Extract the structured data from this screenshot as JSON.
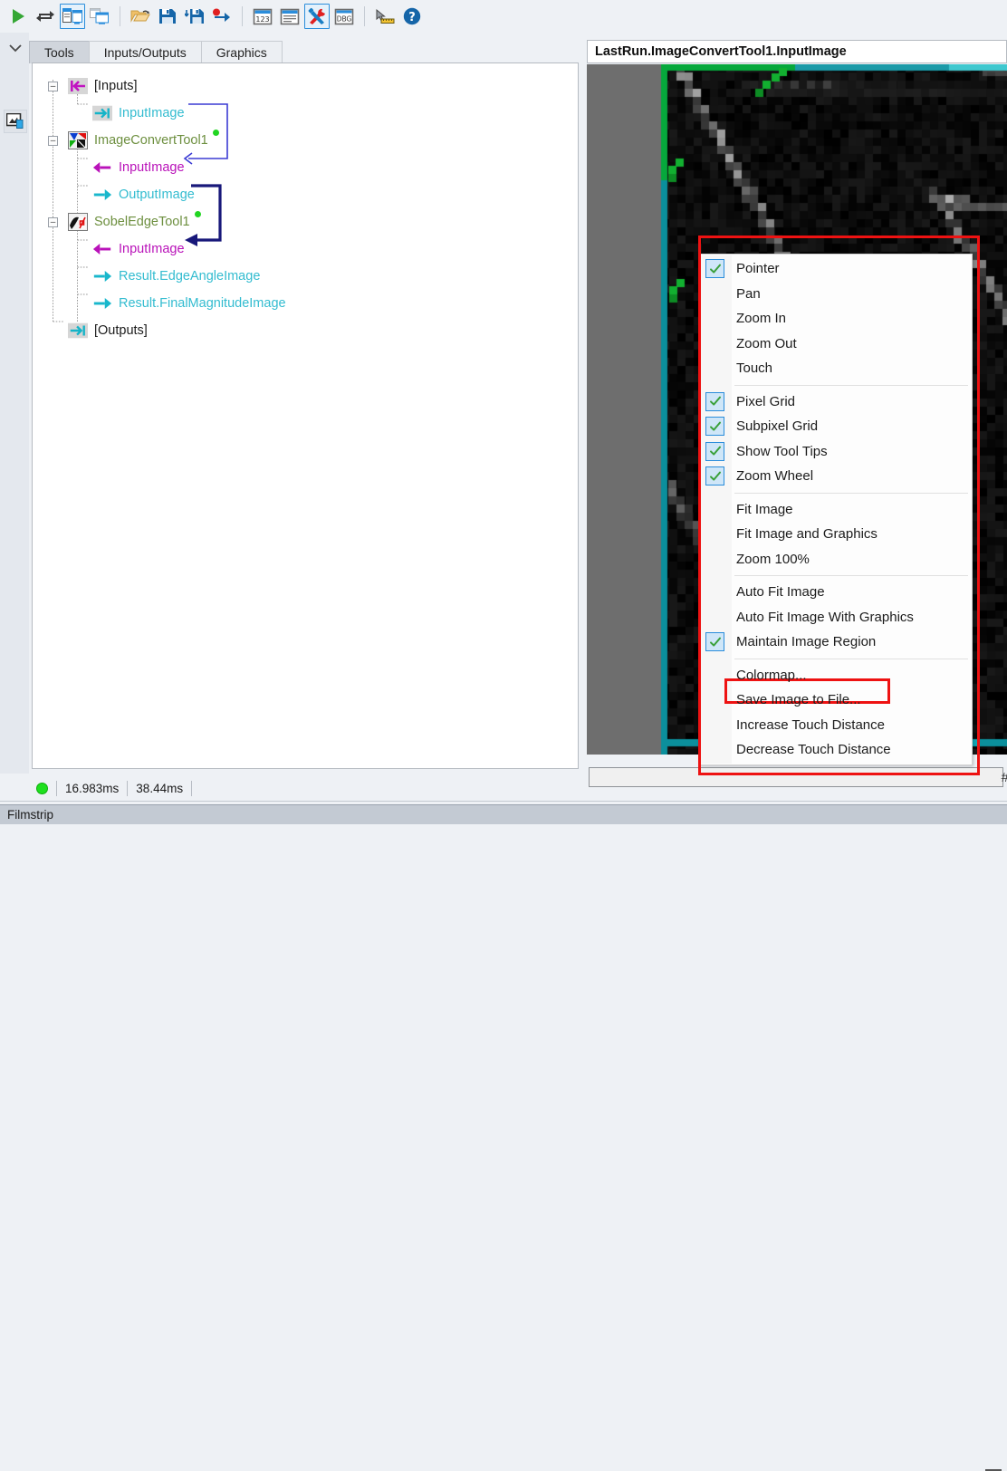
{
  "toolbar": {
    "buttons": [
      {
        "name": "run-button",
        "icon": "play-icon",
        "selected": false
      },
      {
        "name": "run-continuous-button",
        "icon": "loop-arrows-icon",
        "selected": false
      },
      {
        "name": "show-tool-and-display-button",
        "icon": "two-pane-window-icon",
        "selected": true
      },
      {
        "name": "show-display-only-button",
        "icon": "stacked-window-icon",
        "selected": false
      },
      {
        "name": "open-job-button",
        "icon": "open-folder-icon",
        "selected": false
      },
      {
        "name": "save-job-button",
        "icon": "floppy-disk-icon",
        "selected": false
      },
      {
        "name": "save-job-as-button",
        "icon": "floppy-disk-down-icon",
        "selected": false
      },
      {
        "name": "record-button",
        "icon": "red-dot-arrow-icon",
        "selected": false
      },
      {
        "name": "results-numeric-button",
        "icon": "window-123-icon",
        "selected": false
      },
      {
        "name": "results-list-button",
        "icon": "window-list-icon",
        "selected": false
      },
      {
        "name": "tools-button",
        "icon": "screwdriver-wrench-icon",
        "selected": true
      },
      {
        "name": "debug-button",
        "icon": "dbg-icon",
        "selected": false
      },
      {
        "name": "calibration-button",
        "icon": "ruler-cursor-icon",
        "selected": false
      },
      {
        "name": "help-button",
        "icon": "question-circle-icon",
        "selected": false
      }
    ]
  },
  "leftrail": {
    "collapse_icon": "chevron-down-icon",
    "palette_icon": "image-thumbnail-icon"
  },
  "tabs": [
    {
      "label": "Tools",
      "active": true
    },
    {
      "label": "Inputs/Outputs",
      "active": false
    },
    {
      "label": "Graphics",
      "active": false
    }
  ],
  "tree": [
    {
      "label": "[Inputs]",
      "kind": "group",
      "color": "black",
      "expander": "minus",
      "icon": "inputs-arrow-icon",
      "indent": 0
    },
    {
      "label": "InputImage",
      "kind": "terminal",
      "color": "cyan",
      "expander": "none",
      "icon": "input-pin-icon",
      "indent": 1
    },
    {
      "label": "ImageConvertTool1",
      "kind": "tool",
      "color": "green",
      "expander": "minus",
      "icon": "image-convert-tool-icon",
      "indent": 0,
      "status": "ok"
    },
    {
      "label": "InputImage",
      "kind": "terminal",
      "color": "magenta",
      "expander": "none",
      "icon": "arrow-left-icon",
      "indent": 1
    },
    {
      "label": "OutputImage",
      "kind": "terminal",
      "color": "cyan",
      "expander": "none",
      "icon": "arrow-right-icon",
      "indent": 1
    },
    {
      "label": "SobelEdgeTool1",
      "kind": "tool",
      "color": "green",
      "expander": "minus",
      "icon": "sobel-edge-tool-icon",
      "indent": 0,
      "status": "ok"
    },
    {
      "label": "InputImage",
      "kind": "terminal",
      "color": "magenta",
      "expander": "none",
      "icon": "arrow-left-icon",
      "indent": 1
    },
    {
      "label": "Result.EdgeAngleImage",
      "kind": "terminal",
      "color": "cyan",
      "expander": "none",
      "icon": "arrow-right-icon",
      "indent": 1
    },
    {
      "label": "Result.FinalMagnitudeImage",
      "kind": "terminal",
      "color": "cyan",
      "expander": "none",
      "icon": "arrow-right-icon",
      "indent": 1
    },
    {
      "label": "[Outputs]",
      "kind": "group",
      "color": "black",
      "expander": "none",
      "icon": "outputs-arrow-icon",
      "indent": 0
    }
  ],
  "status": {
    "indicator": "green-circle-icon",
    "time_1": "16.983ms",
    "time_2": "38.44ms"
  },
  "filmstrip": {
    "label": "Filmstrip"
  },
  "display": {
    "title": "LastRun.ImageConvertTool1.InputImage",
    "scroll_plus": "#"
  },
  "context_menu": {
    "items": [
      {
        "label": "Pointer",
        "checked": true
      },
      {
        "label": "Pan",
        "checked": false
      },
      {
        "label": "Zoom In",
        "checked": false
      },
      {
        "label": "Zoom Out",
        "checked": false
      },
      {
        "label": "Touch",
        "checked": false
      },
      {
        "separator": true
      },
      {
        "label": "Pixel Grid",
        "checked": true
      },
      {
        "label": "Subpixel Grid",
        "checked": true
      },
      {
        "label": "Show Tool Tips",
        "checked": true
      },
      {
        "label": "Zoom Wheel",
        "checked": true
      },
      {
        "separator": true
      },
      {
        "label": "Fit Image",
        "checked": false
      },
      {
        "label": "Fit Image and Graphics",
        "checked": false
      },
      {
        "label": "Zoom 100%",
        "checked": false
      },
      {
        "separator": true
      },
      {
        "label": "Auto Fit Image",
        "checked": false
      },
      {
        "label": "Auto Fit Image With Graphics",
        "checked": false
      },
      {
        "label": "Maintain Image Region",
        "checked": true
      },
      {
        "separator": true
      },
      {
        "label": "Colormap...",
        "checked": false
      },
      {
        "label": "Save Image to File...",
        "checked": false,
        "highlighted": true
      },
      {
        "label": "Increase Touch Distance",
        "checked": false
      },
      {
        "label": "Decrease Touch Distance",
        "checked": false
      }
    ]
  },
  "annotations": {
    "menu_outline_color": "#ee1212",
    "highlight_item_color": "#ee1212"
  },
  "colors": {
    "accent": "#2a8ddb",
    "tool_green": "#6d8f3f",
    "terminal_cyan": "#33bcd0",
    "terminal_magenta": "#b912b9",
    "ok_dot": "#22d522",
    "image_bg": "#6e6e6e",
    "image_border_green": "#06a83c",
    "image_border_teal": "#1b9aa8"
  }
}
